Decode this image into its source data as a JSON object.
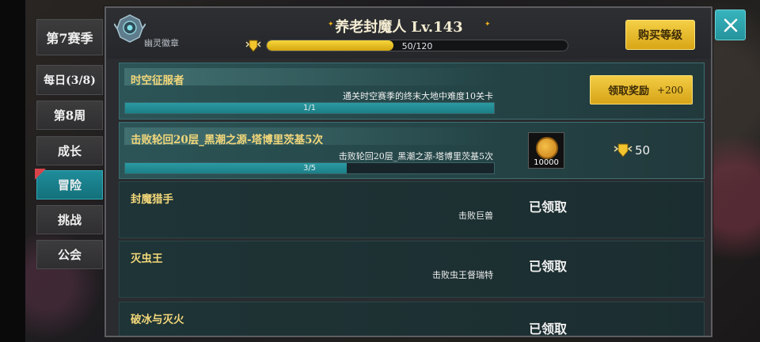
{
  "sidebar": {
    "items": [
      {
        "label": "第7赛季"
      },
      {
        "label": "每日(3/8)"
      },
      {
        "label": "第8周"
      },
      {
        "label": "成长"
      },
      {
        "label": "冒险"
      },
      {
        "label": "挑战"
      },
      {
        "label": "公会"
      }
    ],
    "active_index": 4
  },
  "header": {
    "badge_label": "幽灵徽章",
    "title": "养老封魔人 Lv.143",
    "xp_text": "50/120",
    "xp_progress": 0.42,
    "buy_label": "购买等级"
  },
  "missions": [
    {
      "name": "时空征服者",
      "desc": "通关时空赛季的终末大地中难度10关卡",
      "progress_text": "1/1",
      "progress": 1.0,
      "claim_label": "领取奖励",
      "claim_points": "+200"
    },
    {
      "name": "击败轮回20层_黑潮之源-塔博里茨基5次",
      "desc": "击败轮回20层_黑潮之源-塔博里茨基5次",
      "progress_text": "3/5",
      "progress": 0.6,
      "reward_amount": "10000",
      "points": "50"
    },
    {
      "name": "封魔猎手",
      "desc": "击败巨兽",
      "status": "已领取"
    },
    {
      "name": "灭虫王",
      "desc": "击败虫王督瑞特",
      "status": "已领取"
    },
    {
      "name": "破冰与灭火",
      "status": "已领取"
    }
  ],
  "colors": {
    "accent_teal": "#1f8d9a",
    "gold": "#f3cc45",
    "mission_title": "#f2d77a"
  }
}
